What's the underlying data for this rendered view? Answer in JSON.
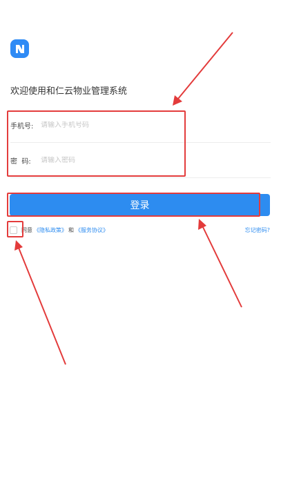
{
  "header": {
    "welcome_text": "欢迎使用和仁云物业管理系统",
    "logo_icon": "app-logo-icon",
    "accent_color": "#2f8bf5"
  },
  "form": {
    "phone_label": "手机号:",
    "phone_placeholder": "请输入手机号码",
    "phone_value": "",
    "password_label": "密  码:",
    "password_placeholder": "请输入密码",
    "password_value": ""
  },
  "login_button": {
    "label": "登录",
    "color": "#2d8cf0"
  },
  "agreement": {
    "agree_text": "同意",
    "privacy_link": "《隐私政策》",
    "and_text": "和",
    "service_link": "《服务协议》",
    "checked": false,
    "forgot_password": "忘记密码?"
  },
  "annotations": {
    "highlight_color": "#e33b3b"
  }
}
